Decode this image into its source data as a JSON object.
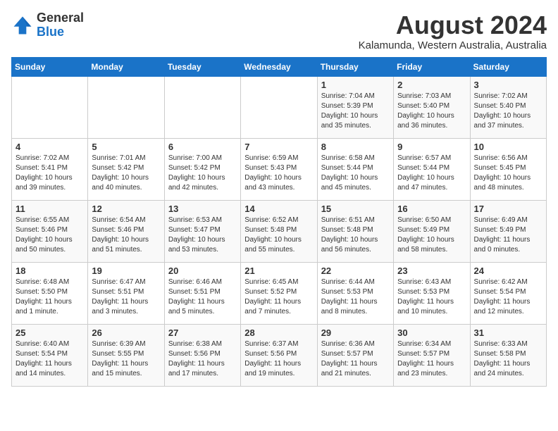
{
  "header": {
    "logo_general": "General",
    "logo_blue": "Blue",
    "month_year": "August 2024",
    "location": "Kalamunda, Western Australia, Australia"
  },
  "weekdays": [
    "Sunday",
    "Monday",
    "Tuesday",
    "Wednesday",
    "Thursday",
    "Friday",
    "Saturday"
  ],
  "weeks": [
    [
      {
        "day": "",
        "info": ""
      },
      {
        "day": "",
        "info": ""
      },
      {
        "day": "",
        "info": ""
      },
      {
        "day": "",
        "info": ""
      },
      {
        "day": "1",
        "info": "Sunrise: 7:04 AM\nSunset: 5:39 PM\nDaylight: 10 hours\nand 35 minutes."
      },
      {
        "day": "2",
        "info": "Sunrise: 7:03 AM\nSunset: 5:40 PM\nDaylight: 10 hours\nand 36 minutes."
      },
      {
        "day": "3",
        "info": "Sunrise: 7:02 AM\nSunset: 5:40 PM\nDaylight: 10 hours\nand 37 minutes."
      }
    ],
    [
      {
        "day": "4",
        "info": "Sunrise: 7:02 AM\nSunset: 5:41 PM\nDaylight: 10 hours\nand 39 minutes."
      },
      {
        "day": "5",
        "info": "Sunrise: 7:01 AM\nSunset: 5:42 PM\nDaylight: 10 hours\nand 40 minutes."
      },
      {
        "day": "6",
        "info": "Sunrise: 7:00 AM\nSunset: 5:42 PM\nDaylight: 10 hours\nand 42 minutes."
      },
      {
        "day": "7",
        "info": "Sunrise: 6:59 AM\nSunset: 5:43 PM\nDaylight: 10 hours\nand 43 minutes."
      },
      {
        "day": "8",
        "info": "Sunrise: 6:58 AM\nSunset: 5:44 PM\nDaylight: 10 hours\nand 45 minutes."
      },
      {
        "day": "9",
        "info": "Sunrise: 6:57 AM\nSunset: 5:44 PM\nDaylight: 10 hours\nand 47 minutes."
      },
      {
        "day": "10",
        "info": "Sunrise: 6:56 AM\nSunset: 5:45 PM\nDaylight: 10 hours\nand 48 minutes."
      }
    ],
    [
      {
        "day": "11",
        "info": "Sunrise: 6:55 AM\nSunset: 5:46 PM\nDaylight: 10 hours\nand 50 minutes."
      },
      {
        "day": "12",
        "info": "Sunrise: 6:54 AM\nSunset: 5:46 PM\nDaylight: 10 hours\nand 51 minutes."
      },
      {
        "day": "13",
        "info": "Sunrise: 6:53 AM\nSunset: 5:47 PM\nDaylight: 10 hours\nand 53 minutes."
      },
      {
        "day": "14",
        "info": "Sunrise: 6:52 AM\nSunset: 5:48 PM\nDaylight: 10 hours\nand 55 minutes."
      },
      {
        "day": "15",
        "info": "Sunrise: 6:51 AM\nSunset: 5:48 PM\nDaylight: 10 hours\nand 56 minutes."
      },
      {
        "day": "16",
        "info": "Sunrise: 6:50 AM\nSunset: 5:49 PM\nDaylight: 10 hours\nand 58 minutes."
      },
      {
        "day": "17",
        "info": "Sunrise: 6:49 AM\nSunset: 5:49 PM\nDaylight: 11 hours\nand 0 minutes."
      }
    ],
    [
      {
        "day": "18",
        "info": "Sunrise: 6:48 AM\nSunset: 5:50 PM\nDaylight: 11 hours\nand 1 minute."
      },
      {
        "day": "19",
        "info": "Sunrise: 6:47 AM\nSunset: 5:51 PM\nDaylight: 11 hours\nand 3 minutes."
      },
      {
        "day": "20",
        "info": "Sunrise: 6:46 AM\nSunset: 5:51 PM\nDaylight: 11 hours\nand 5 minutes."
      },
      {
        "day": "21",
        "info": "Sunrise: 6:45 AM\nSunset: 5:52 PM\nDaylight: 11 hours\nand 7 minutes."
      },
      {
        "day": "22",
        "info": "Sunrise: 6:44 AM\nSunset: 5:53 PM\nDaylight: 11 hours\nand 8 minutes."
      },
      {
        "day": "23",
        "info": "Sunrise: 6:43 AM\nSunset: 5:53 PM\nDaylight: 11 hours\nand 10 minutes."
      },
      {
        "day": "24",
        "info": "Sunrise: 6:42 AM\nSunset: 5:54 PM\nDaylight: 11 hours\nand 12 minutes."
      }
    ],
    [
      {
        "day": "25",
        "info": "Sunrise: 6:40 AM\nSunset: 5:54 PM\nDaylight: 11 hours\nand 14 minutes."
      },
      {
        "day": "26",
        "info": "Sunrise: 6:39 AM\nSunset: 5:55 PM\nDaylight: 11 hours\nand 15 minutes."
      },
      {
        "day": "27",
        "info": "Sunrise: 6:38 AM\nSunset: 5:56 PM\nDaylight: 11 hours\nand 17 minutes."
      },
      {
        "day": "28",
        "info": "Sunrise: 6:37 AM\nSunset: 5:56 PM\nDaylight: 11 hours\nand 19 minutes."
      },
      {
        "day": "29",
        "info": "Sunrise: 6:36 AM\nSunset: 5:57 PM\nDaylight: 11 hours\nand 21 minutes."
      },
      {
        "day": "30",
        "info": "Sunrise: 6:34 AM\nSunset: 5:57 PM\nDaylight: 11 hours\nand 23 minutes."
      },
      {
        "day": "31",
        "info": "Sunrise: 6:33 AM\nSunset: 5:58 PM\nDaylight: 11 hours\nand 24 minutes."
      }
    ]
  ]
}
